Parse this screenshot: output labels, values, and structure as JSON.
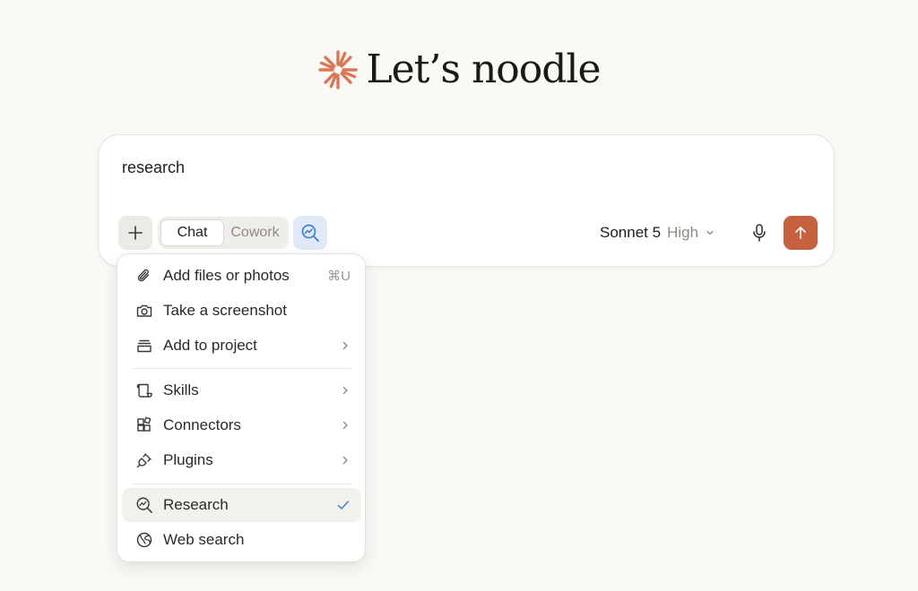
{
  "hero": {
    "title": "Let’s noodle"
  },
  "composer": {
    "prompt_text": "research",
    "modes": [
      {
        "label": "Chat",
        "active": true
      },
      {
        "label": "Cowork",
        "active": false
      }
    ],
    "model": {
      "name": "Sonnet 5",
      "effort": "High"
    }
  },
  "menu": {
    "items": [
      {
        "label": "Add files or photos",
        "icon": "paperclip-icon",
        "shortcut": "⌘U"
      },
      {
        "label": "Take a screenshot",
        "icon": "camera-icon"
      },
      {
        "label": "Add to project",
        "icon": "project-icon",
        "submenu": true
      },
      {
        "label": "Skills",
        "icon": "scroll-icon",
        "submenu": true
      },
      {
        "label": "Connectors",
        "icon": "connectors-icon",
        "submenu": true
      },
      {
        "label": "Plugins",
        "icon": "plug-icon",
        "submenu": true
      },
      {
        "label": "Research",
        "icon": "research-icon",
        "selected": true
      },
      {
        "label": "Web search",
        "icon": "globe-icon"
      }
    ]
  },
  "colors": {
    "background": "#faf9f5",
    "accent": "#c6613f",
    "research_accent": "#3b7fd9",
    "text": "#1f1e1b",
    "muted": "#8d8a83"
  }
}
